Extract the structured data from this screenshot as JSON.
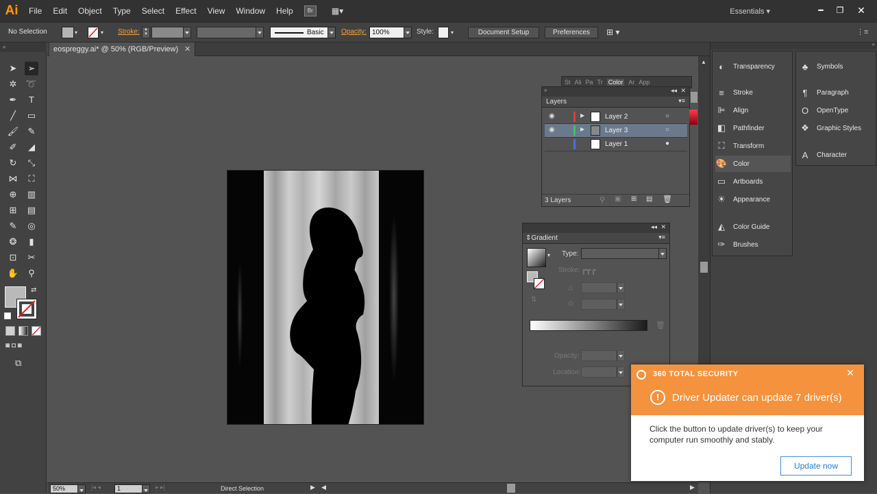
{
  "app": {
    "logo": "Ai"
  },
  "menu": [
    "File",
    "Edit",
    "Object",
    "Type",
    "Select",
    "Effect",
    "View",
    "Window",
    "Help"
  ],
  "workspace": {
    "label": "Essentials"
  },
  "control": {
    "selection": "No Selection",
    "stroke_label": "Stroke:",
    "profile": "Basic",
    "opacity_label": "Opacity:",
    "opacity_value": "100%",
    "style_label": "Style:",
    "document_setup": "Document Setup",
    "preferences": "Preferences"
  },
  "document": {
    "tab_title": "eospreggy.ai* @ 50% (RGB/Preview)"
  },
  "panel_tabs": [
    "St",
    "Ali",
    "Pa",
    "Tr",
    "Color",
    "Ar",
    "App"
  ],
  "layers": {
    "title": "Layers",
    "rows": [
      {
        "name": "Layer 2",
        "color": "#d94040"
      },
      {
        "name": "Layer 3",
        "color": "#3dc45a"
      },
      {
        "name": "Layer 1",
        "color": "#4c6fd6"
      }
    ],
    "footer": "3 Layers"
  },
  "gradient": {
    "title": "Gradient",
    "type_label": "Type:",
    "stroke_label": "Stroke:",
    "opacity_label": "Opacity:",
    "location_label": "Location:"
  },
  "right_panels_col1": [
    {
      "label": "Transparency",
      "icon": "transparency-icon"
    },
    {
      "label": "Stroke",
      "icon": "stroke-icon"
    },
    {
      "label": "Align",
      "icon": "align-icon"
    },
    {
      "label": "Pathfinder",
      "icon": "pathfinder-icon"
    },
    {
      "label": "Transform",
      "icon": "transform-icon"
    },
    {
      "label": "Color",
      "icon": "color-icon"
    },
    {
      "label": "Artboards",
      "icon": "artboards-icon"
    },
    {
      "label": "Appearance",
      "icon": "appearance-icon"
    },
    {
      "label": "Color Guide",
      "icon": "color-guide-icon"
    },
    {
      "label": "Brushes",
      "icon": "brushes-icon"
    }
  ],
  "right_panels_col2": [
    {
      "label": "Symbols",
      "icon": "symbols-icon"
    },
    {
      "label": "Paragraph",
      "icon": "paragraph-icon"
    },
    {
      "label": "OpenType",
      "icon": "opentype-icon"
    },
    {
      "label": "Graphic Styles",
      "icon": "graphic-styles-icon"
    },
    {
      "label": "Character",
      "icon": "character-icon"
    }
  ],
  "status": {
    "zoom": "50%",
    "page": "1",
    "tool": "Direct Selection"
  },
  "toast": {
    "brand": "360 TOTAL SECURITY",
    "headline": "Driver Updater can update 7 driver(s)",
    "body": "Click the button to update driver(s) to keep your computer run smoothly and stably.",
    "button": "Update now",
    "accent": "#f5923e"
  }
}
